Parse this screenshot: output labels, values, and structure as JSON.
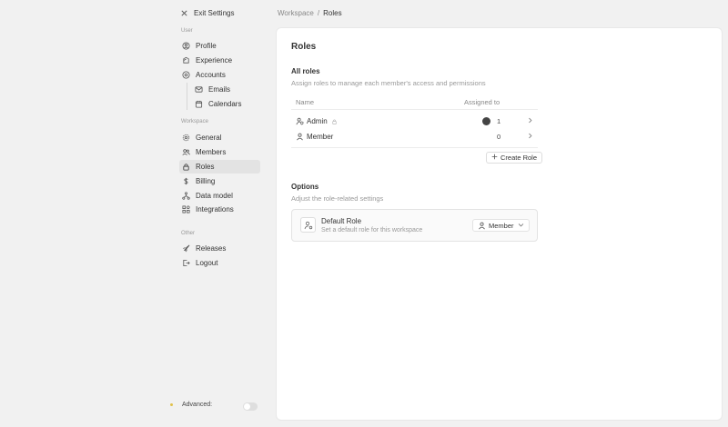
{
  "sidebar": {
    "exit_label": "Exit Settings",
    "sections": {
      "user": "User",
      "workspace": "Workspace",
      "other": "Other"
    },
    "items": {
      "profile": "Profile",
      "experience": "Experience",
      "accounts": "Accounts",
      "emails": "Emails",
      "calendars": "Calendars",
      "general": "General",
      "members": "Members",
      "roles": "Roles",
      "billing": "Billing",
      "data_model": "Data model",
      "integrations": "Integrations",
      "releases": "Releases",
      "logout": "Logout"
    },
    "advanced_label": "Advanced:",
    "advanced_enabled": false,
    "advanced_dot_color": "#e0c04a"
  },
  "breadcrumb": {
    "parent": "Workspace",
    "separator": "/",
    "current": "Roles"
  },
  "main": {
    "title": "Roles",
    "all_roles": {
      "heading": "All roles",
      "description": "Assign roles to manage each member's access and permissions",
      "columns": {
        "name": "Name",
        "assigned": "Assigned to"
      },
      "rows": [
        {
          "name": "Admin",
          "count": "1"
        },
        {
          "name": "Member",
          "count": "0"
        }
      ],
      "create_label": "Create Role"
    },
    "options": {
      "heading": "Options",
      "description": "Adjust the role-related settings",
      "default_role": {
        "title": "Default Role",
        "description": "Set a default role for this workspace",
        "value": "Member"
      }
    }
  },
  "colors": {
    "background": "#f1f1f1",
    "panel": "#ffffff",
    "active_nav": "#e3e3e3"
  }
}
